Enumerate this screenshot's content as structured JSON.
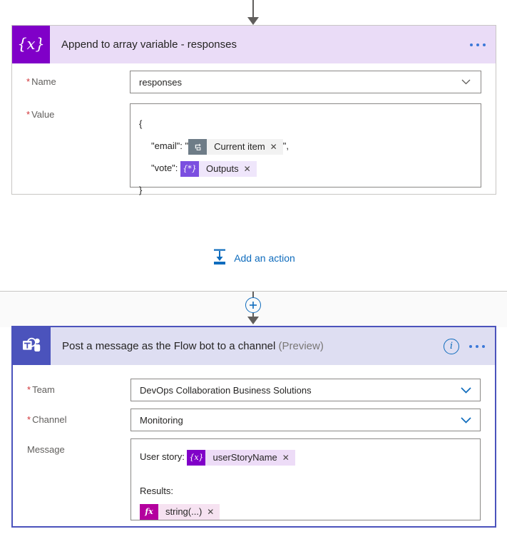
{
  "flow": {
    "connector_top": {
      "icon": "down-arrow-icon"
    },
    "connector_middle": {
      "icon": "plus-circle-icon"
    }
  },
  "append_card": {
    "icon": "variable-braces-icon",
    "icon_glyph": "{x}",
    "title": "Append to array variable - responses",
    "menu_icon": "ellipsis-icon",
    "fields": {
      "name": {
        "label": "Name",
        "required": true,
        "value": "responses",
        "chevron_icon": "chevron-down-icon"
      },
      "value": {
        "label": "Value",
        "required": true,
        "line_open": "{",
        "line_email_key": "\"email\": \"",
        "line_email_tail": "\",",
        "line_vote_key": "\"vote\":",
        "line_close": "}",
        "tokens": [
          {
            "name": "Current item",
            "icon": "loop-current-item-icon",
            "icon_glyph": "⟲",
            "remove_icon": "close-icon",
            "remove_glyph": "✕"
          },
          {
            "name": "Outputs",
            "icon": "expression-outputs-icon",
            "icon_glyph": "{*}",
            "remove_icon": "close-icon",
            "remove_glyph": "✕"
          }
        ]
      }
    }
  },
  "add_action": {
    "label": "Add an action",
    "icon": "add-action-icon",
    "color": "#0F6CBD"
  },
  "teams_card": {
    "icon": "microsoft-teams-icon",
    "title": "Post a message as the Flow bot to a channel",
    "preview_tag": "(Preview)",
    "info_icon": "info-circle-icon",
    "info_glyph": "i",
    "menu_icon": "ellipsis-icon",
    "border_color": "#4B53BC",
    "fields": {
      "team": {
        "label": "Team",
        "required": true,
        "value": "DevOps Collaboration Business Solutions",
        "chevron_icon": "chevron-down-icon"
      },
      "channel": {
        "label": "Channel",
        "required": true,
        "value": "Monitoring",
        "chevron_icon": "chevron-down-icon"
      },
      "message": {
        "label": "Message",
        "required": false,
        "line_user_story": "User story:",
        "line_results": "Results:",
        "tokens": [
          {
            "name": "userStoryName",
            "icon": "variable-braces-icon",
            "icon_glyph": "{x}",
            "remove_icon": "close-icon",
            "remove_glyph": "✕"
          },
          {
            "name": "string(...)",
            "icon": "function-fx-icon",
            "icon_glyph": "fx",
            "remove_icon": "close-icon",
            "remove_glyph": "✕"
          }
        ]
      }
    }
  }
}
